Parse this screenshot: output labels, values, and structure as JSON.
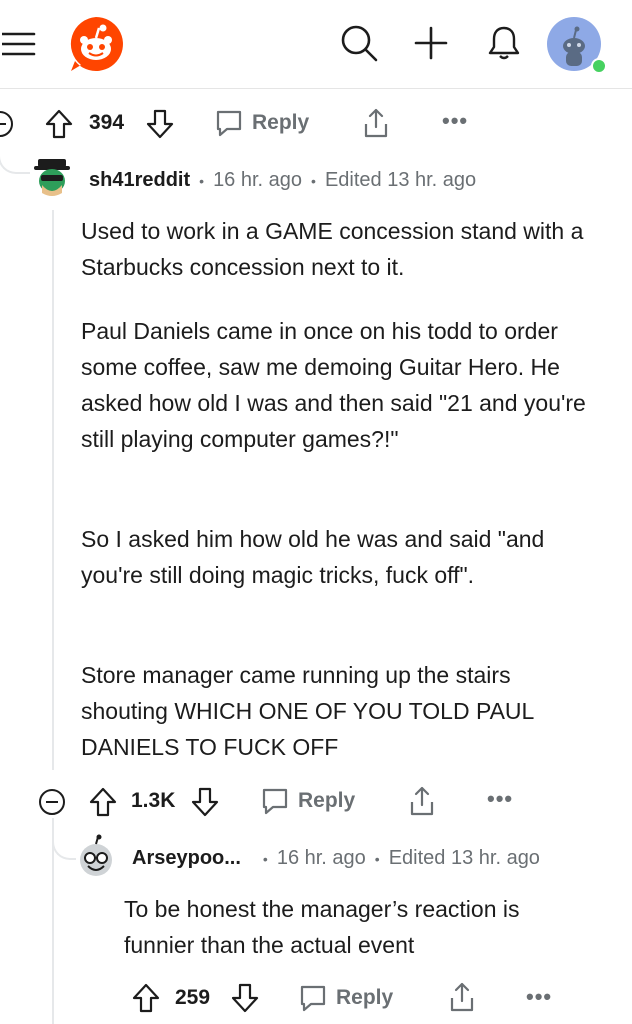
{
  "header": {
    "menu_icon": "hamburger-menu-icon",
    "logo_icon": "reddit-snoo-logo-icon",
    "search_icon": "search-icon",
    "create_icon": "plus-icon",
    "notifications_icon": "bell-icon",
    "avatar_icon": "user-avatar-icon",
    "online_color": "#46d160",
    "brand_color": "#ff4500"
  },
  "parent_actions": {
    "votes": "394",
    "reply_label": "Reply"
  },
  "comment": {
    "username": "sh41reddit",
    "time": "16 hr. ago",
    "edited": "Edited 13 hr. ago",
    "paragraphs": [
      "Used to work in a GAME concession stand with a Starbucks concession next to it.",
      "Paul Daniels came in once on his todd to order some coffee, saw me demoing Guitar Hero. He asked how old I was and then said \"21 and you're still playing computer games?!\"",
      "So I asked him how old he was and said \"and you're still doing magic tricks, fuck off\".",
      "Store manager came running up the stairs shouting WHICH ONE OF YOU TOLD PAUL DANIELS TO FUCK OFF"
    ],
    "votes": "1.3K",
    "reply_label": "Reply"
  },
  "reply": {
    "username": "Arseypoo...",
    "time": "16 hr. ago",
    "edited": "Edited 13 hr. ago",
    "text": "To be honest the manager’s reaction is funnier than the actual event",
    "votes": "259",
    "reply_label": "Reply"
  }
}
